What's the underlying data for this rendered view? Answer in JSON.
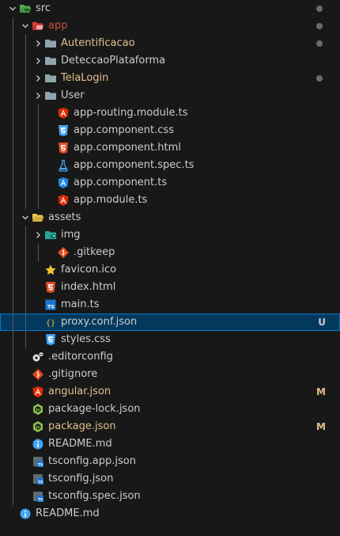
{
  "colors": {
    "background": "#181818",
    "selection": "#04395e",
    "selection_border": "#0078d4",
    "modified": "#e2c08d",
    "untracked": "#73c991",
    "deleted": "#c74e39"
  },
  "tree": [
    {
      "name": "src-folder",
      "label": "src",
      "icon": "folder-src-open-icon",
      "depth": 0,
      "expanded": true,
      "status": "dot"
    },
    {
      "name": "app-folder",
      "label": "app",
      "icon": "folder-app-open-icon",
      "depth": 1,
      "expanded": true,
      "status": "deleted-dot"
    },
    {
      "name": "autentificacao-folder",
      "label": "Autentificacao",
      "icon": "folder-icon",
      "depth": 2,
      "expanded": false,
      "status": "mod-dot"
    },
    {
      "name": "deteccaoplataforma-folder",
      "label": "DeteccaoPlataforma",
      "icon": "folder-icon",
      "depth": 2,
      "expanded": false,
      "status": ""
    },
    {
      "name": "telalogin-folder",
      "label": "TelaLogin",
      "icon": "folder-icon",
      "depth": 2,
      "expanded": false,
      "status": "mod-dot"
    },
    {
      "name": "user-folder",
      "label": "User",
      "icon": "folder-icon",
      "depth": 2,
      "expanded": false,
      "status": ""
    },
    {
      "name": "app-routing-module-file",
      "label": "app-routing.module.ts",
      "icon": "angular-red-icon",
      "depth": 3,
      "file": true,
      "status": ""
    },
    {
      "name": "app-component-css-file",
      "label": "app.component.css",
      "icon": "css-icon",
      "depth": 3,
      "file": true,
      "status": ""
    },
    {
      "name": "app-component-html-file",
      "label": "app.component.html",
      "icon": "html-icon",
      "depth": 3,
      "file": true,
      "status": ""
    },
    {
      "name": "app-component-spec-file",
      "label": "app.component.spec.ts",
      "icon": "test-flask-icon",
      "depth": 3,
      "file": true,
      "status": ""
    },
    {
      "name": "app-component-ts-file",
      "label": "app.component.ts",
      "icon": "angular-blue-icon",
      "depth": 3,
      "file": true,
      "status": ""
    },
    {
      "name": "app-module-file",
      "label": "app.module.ts",
      "icon": "angular-red-icon",
      "depth": 3,
      "file": true,
      "status": ""
    },
    {
      "name": "assets-folder",
      "label": "assets",
      "icon": "folder-open-icon",
      "depth": 1,
      "expanded": true,
      "status": ""
    },
    {
      "name": "img-folder",
      "label": "img",
      "icon": "folder-images-icon",
      "depth": 2,
      "expanded": false,
      "status": ""
    },
    {
      "name": "gitkeep-file",
      "label": ".gitkeep",
      "icon": "git-icon",
      "depth": 3,
      "file": true,
      "status": ""
    },
    {
      "name": "favicon-file",
      "label": "favicon.ico",
      "icon": "star-icon",
      "depth": 2,
      "file": true,
      "status": ""
    },
    {
      "name": "index-html-file",
      "label": "index.html",
      "icon": "html-icon",
      "depth": 2,
      "file": true,
      "status": ""
    },
    {
      "name": "main-ts-file",
      "label": "main.ts",
      "icon": "ts-icon",
      "depth": 2,
      "file": true,
      "status": ""
    },
    {
      "name": "proxy-conf-file",
      "label": "proxy.conf.json",
      "icon": "json-braces-icon",
      "depth": 2,
      "file": true,
      "status": "untracked",
      "decoration": "U",
      "selected": true
    },
    {
      "name": "styles-css-file",
      "label": "styles.css",
      "icon": "css-icon",
      "depth": 2,
      "file": true,
      "status": ""
    },
    {
      "name": "editorconfig-file",
      "label": ".editorconfig",
      "icon": "editorconfig-icon",
      "depth": 1,
      "file": true,
      "status": ""
    },
    {
      "name": "gitignore-file",
      "label": ".gitignore",
      "icon": "git-icon",
      "depth": 1,
      "file": true,
      "status": ""
    },
    {
      "name": "angular-json-file",
      "label": "angular.json",
      "icon": "angular-red-icon",
      "depth": 1,
      "file": true,
      "status": "modified",
      "decoration": "M"
    },
    {
      "name": "package-lock-file",
      "label": "package-lock.json",
      "icon": "nodejs-icon",
      "depth": 1,
      "file": true,
      "status": ""
    },
    {
      "name": "package-json-file",
      "label": "package.json",
      "icon": "nodejs-icon",
      "depth": 1,
      "file": true,
      "status": "modified",
      "decoration": "M"
    },
    {
      "name": "readme-inner-file",
      "label": "README.md",
      "icon": "info-icon",
      "depth": 1,
      "file": true,
      "status": ""
    },
    {
      "name": "tsconfig-app-file",
      "label": "tsconfig.app.json",
      "icon": "tsconfig-icon",
      "depth": 1,
      "file": true,
      "status": ""
    },
    {
      "name": "tsconfig-file",
      "label": "tsconfig.json",
      "icon": "tsconfig-icon",
      "depth": 1,
      "file": true,
      "status": ""
    },
    {
      "name": "tsconfig-spec-file",
      "label": "tsconfig.spec.json",
      "icon": "tsconfig-icon",
      "depth": 1,
      "file": true,
      "status": ""
    },
    {
      "name": "readme-root-file",
      "label": "README.md",
      "icon": "info-icon",
      "depth": 0,
      "file": true,
      "status": ""
    }
  ]
}
